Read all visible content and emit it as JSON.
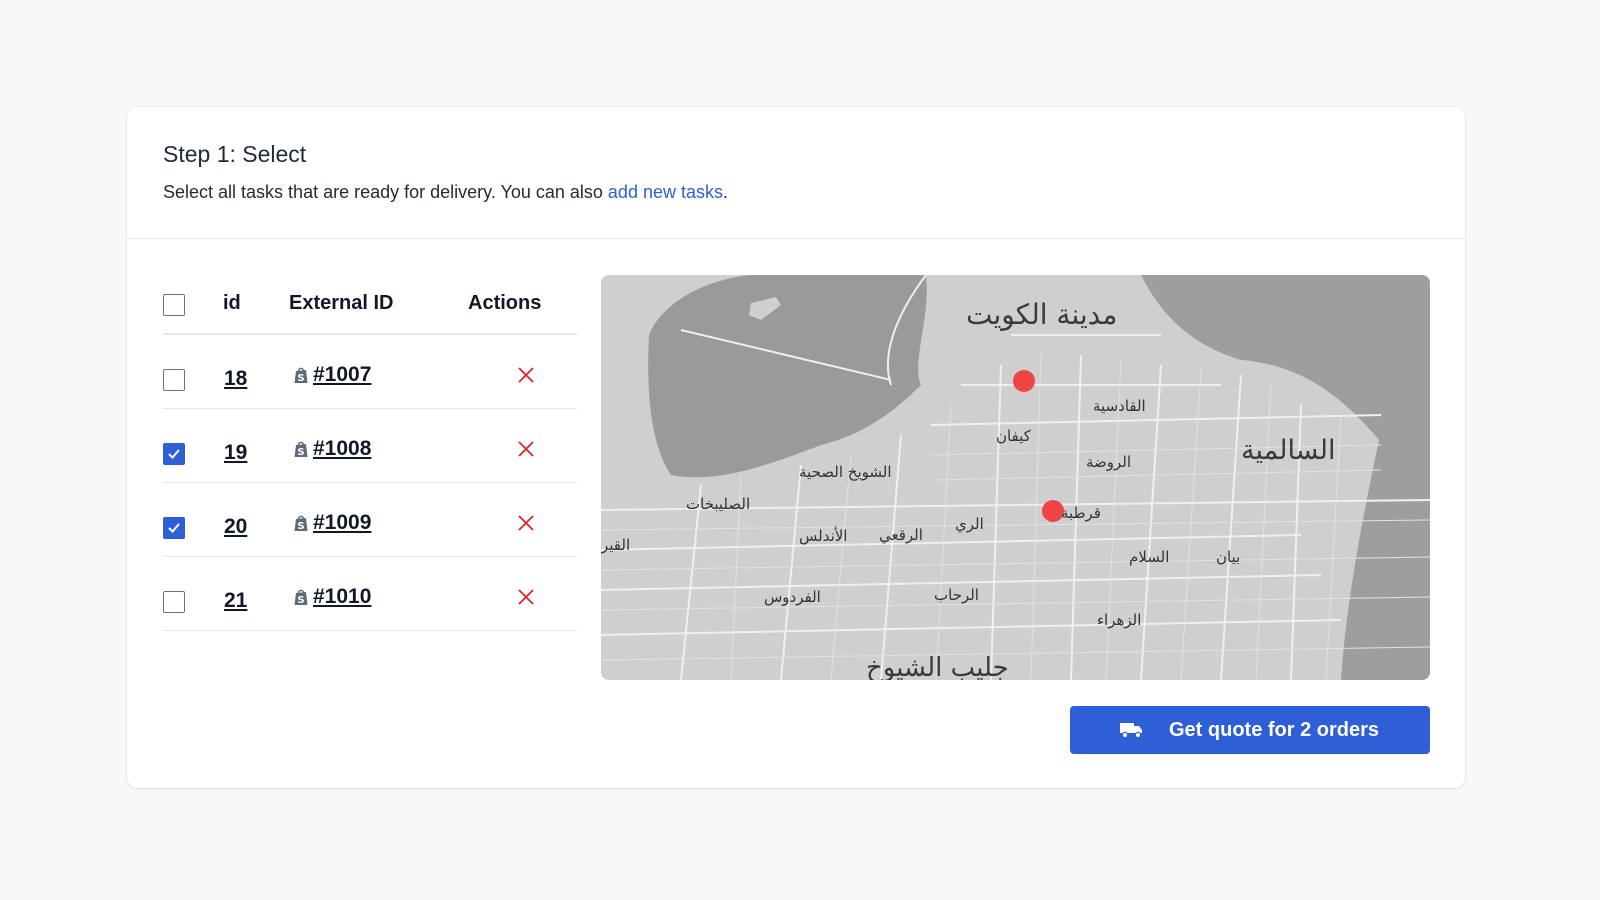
{
  "header": {
    "title": "Step 1: Select",
    "description": "Select all tasks that are ready for delivery. You can also ",
    "link_text": "add new tasks",
    "description_end": "."
  },
  "table": {
    "columns": [
      "id",
      "External ID",
      "Actions"
    ],
    "rows": [
      {
        "id": "18",
        "external_id": "#1007",
        "checked": false
      },
      {
        "id": "19",
        "external_id": "#1008",
        "checked": true
      },
      {
        "id": "20",
        "external_id": "#1009",
        "checked": true
      },
      {
        "id": "21",
        "external_id": "#1010",
        "checked": false
      }
    ]
  },
  "map": {
    "labels": {
      "kuwait_city": "مدينة الكويت",
      "salmiya": "السالمية",
      "qadsiya": "القادسية",
      "kaifan": "كيفان",
      "rawda": "الروضة",
      "shuwaikh": "الشويخ الصحية",
      "sulaibikhat": "الصليبخات",
      "qairawan": "القير",
      "andalus": "الأندلس",
      "riggae": "الرقعي",
      "rai": "الري",
      "qurtuba": "قرطبة",
      "salam": "السلام",
      "bayan": "بيان",
      "firdous": "الفردوس",
      "rehab": "الرحاب",
      "zahra": "الزهراء",
      "jleeb": "جليب الشيوخ"
    },
    "marker_color": "#ef4444"
  },
  "quote_button": {
    "label": "Get quote for 2 orders"
  },
  "colors": {
    "accent": "#2e5fd6",
    "danger": "#dc2626"
  }
}
